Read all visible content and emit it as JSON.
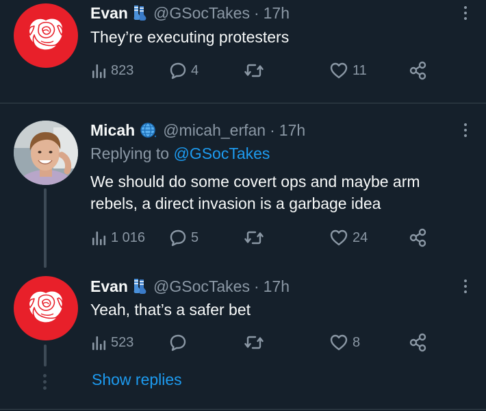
{
  "tweets": [
    {
      "display_name": "Evan",
      "badge": "socks-emoji-icon",
      "handle": "@GSocTakes",
      "separator": "·",
      "time": "17h",
      "text": "They’re executing protesters",
      "views": "823",
      "replies": "4",
      "retweets": "",
      "likes": "11"
    },
    {
      "display_name": "Micah",
      "badge": "globe-emoji-icon",
      "handle": "@micah_erfan",
      "separator": "·",
      "time": "17h",
      "replying_prefix": "Replying to",
      "replying_handle": "@GSocTakes",
      "text": "We should do some covert ops and maybe arm rebels, a direct invasion is a garbage idea",
      "views": "1 016",
      "replies": "5",
      "retweets": "",
      "likes": "24"
    },
    {
      "display_name": "Evan",
      "badge": "socks-emoji-icon",
      "handle": "@GSocTakes",
      "separator": "·",
      "time": "17h",
      "text": "Yeah, that’s a safer bet",
      "views": "523",
      "replies": "",
      "retweets": "",
      "likes": "8"
    }
  ],
  "show_replies": "Show replies",
  "colors": {
    "background": "#15202b",
    "text": "#f7f9f9",
    "muted": "#8b98a5",
    "link": "#1d9bf0",
    "rose_avatar": "#e8202a",
    "divider": "#38444d"
  }
}
